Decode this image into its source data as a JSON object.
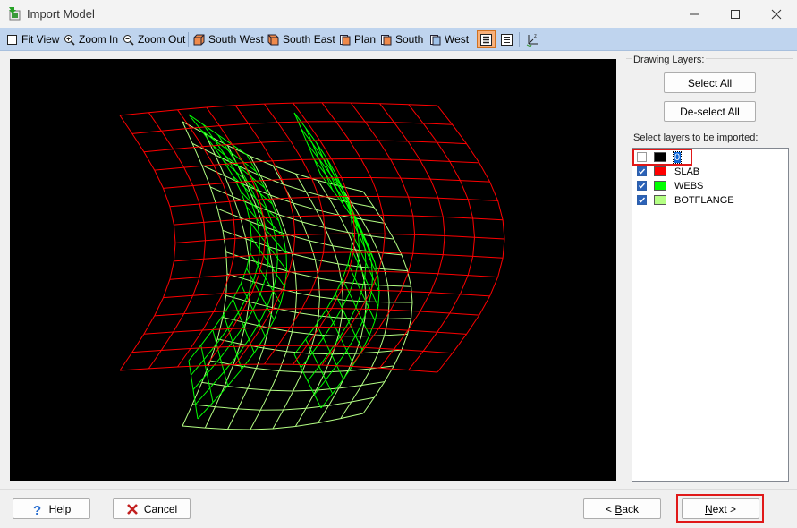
{
  "window": {
    "title": "Import Model",
    "app_icon": "import-model-icon"
  },
  "toolbar": {
    "fit_view": "Fit View",
    "zoom_in": "Zoom In",
    "zoom_out": "Zoom Out",
    "south_west": "South West",
    "south_east": "South East",
    "plan": "Plan",
    "south": "South",
    "west": "West"
  },
  "layers": {
    "group_label": "Drawing Layers:",
    "select_all": "Select All",
    "deselect_all": "De-select All",
    "select_label": "Select layers to be imported:",
    "items": [
      {
        "name": "0",
        "checked": false,
        "color": "#000000",
        "selected": true
      },
      {
        "name": "SLAB",
        "checked": true,
        "color": "#ff0000",
        "selected": false
      },
      {
        "name": "WEBS",
        "checked": true,
        "color": "#00ff00",
        "selected": false
      },
      {
        "name": "BOTFLANGE",
        "checked": true,
        "color": "#b4ff84",
        "selected": false
      }
    ]
  },
  "footer": {
    "help": "Help",
    "cancel": "Cancel",
    "back_prefix": "< ",
    "back_u": "B",
    "back_rest": "ack",
    "next_u": "N",
    "next_rest": "ext >"
  },
  "colors": {
    "slab": "#ff0000",
    "webs": "#00ff00",
    "botflange": "#b4ff84",
    "highlight_box": "#e01919",
    "toolbar_bg": "#bfd4ee"
  }
}
